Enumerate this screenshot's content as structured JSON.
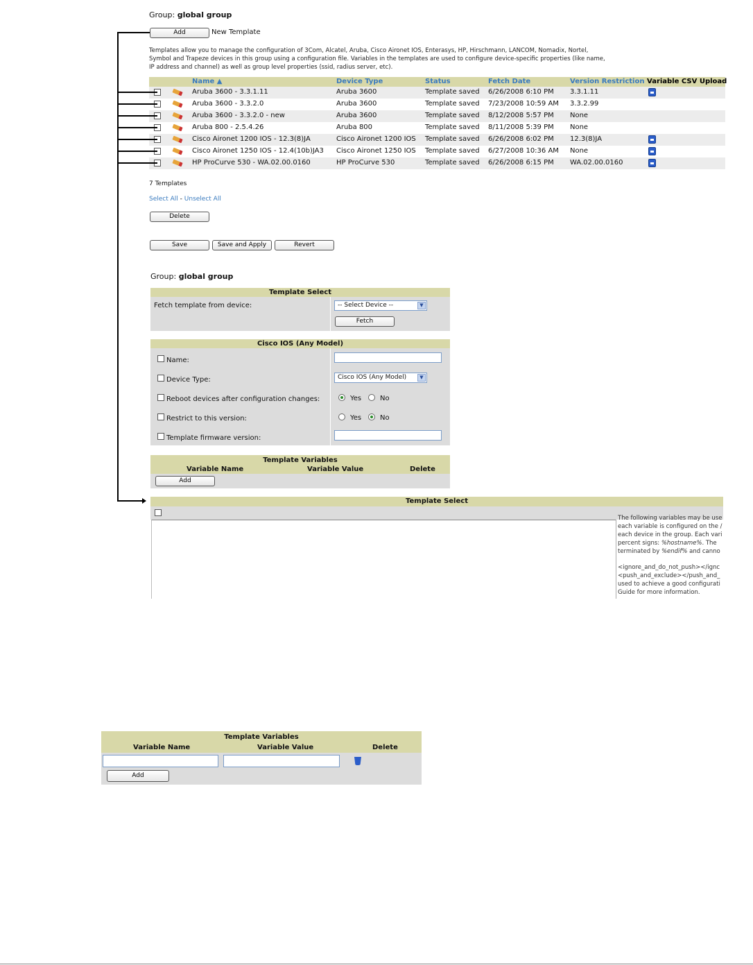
{
  "top": {
    "group_label": "Group:",
    "group_name": "global group",
    "add_button": "Add",
    "new_template_label": "New Template",
    "description_1": "Templates allow you to manage the configuration of 3Com, Alcatel, Aruba, Cisco Aironet IOS, Enterasys, HP, Hirschmann, LANCOM, Nomadix, Nortel,",
    "description_2": "Symbol and Trapeze devices in this group using a configuration file. Variables in the templates are used to configure device-specific properties (like name,",
    "description_3": "IP address and channel) as well as group level properties (ssid, radius server, etc)."
  },
  "table": {
    "headers": {
      "name": "Name ▲",
      "device_type": "Device Type",
      "status": "Status",
      "fetch_date": "Fetch Date",
      "version_restriction": "Version Restriction",
      "variable_csv_upload": "Variable CSV Upload"
    },
    "rows": [
      {
        "name": "Aruba 3600 - 3.3.1.11",
        "device_type": "Aruba 3600",
        "status": "Template saved",
        "fetch_date": "6/26/2008 6:10 PM",
        "version": "3.3.1.11",
        "csv": true
      },
      {
        "name": "Aruba 3600 - 3.3.2.0",
        "device_type": "Aruba 3600",
        "status": "Template saved",
        "fetch_date": "7/23/2008 10:59 AM",
        "version": "3.3.2.99",
        "csv": false
      },
      {
        "name": "Aruba 3600 - 3.3.2.0 - new",
        "device_type": "Aruba 3600",
        "status": "Template saved",
        "fetch_date": "8/12/2008 5:57 PM",
        "version": "None",
        "csv": false
      },
      {
        "name": "Aruba 800 - 2.5.4.26",
        "device_type": "Aruba 800",
        "status": "Template saved",
        "fetch_date": "8/11/2008 5:39 PM",
        "version": "None",
        "csv": false
      },
      {
        "name": "Cisco Aironet 1200 IOS - 12.3(8)JA",
        "device_type": "Cisco Aironet 1200 IOS",
        "status": "Template saved",
        "fetch_date": "6/26/2008 6:02 PM",
        "version": "12.3(8)JA",
        "csv": true
      },
      {
        "name": "Cisco Aironet 1250 IOS - 12.4(10b)JA3",
        "device_type": "Cisco Aironet 1250 IOS",
        "status": "Template saved",
        "fetch_date": "6/27/2008 10:36 AM",
        "version": "None",
        "csv": true
      },
      {
        "name": "HP ProCurve 530 - WA.02.00.0160",
        "device_type": "HP ProCurve 530",
        "status": "Template saved",
        "fetch_date": "6/26/2008 6:15 PM",
        "version": "WA.02.00.0160",
        "csv": true
      }
    ],
    "count_label": "7 Templates",
    "select_all": "Select All",
    "separator": " - ",
    "unselect_all": "Unselect All",
    "delete_button": "Delete",
    "save_button": "Save",
    "save_apply_button": "Save and Apply",
    "revert_button": "Revert"
  },
  "form": {
    "group_label": "Group:",
    "group_name": "global group",
    "template_select_title": "Template Select",
    "fetch_label": "Fetch template from device:",
    "select_device": "-- Select Device --",
    "fetch_button": "Fetch",
    "cisco_title": "Cisco IOS (Any Model)",
    "name_label": "Name:",
    "device_type_label": "Device Type:",
    "device_type_value": "Cisco IOS (Any Model)",
    "reboot_label": "Reboot devices after configuration changes:",
    "restrict_label": "Restrict to this version:",
    "firmware_label": "Template firmware version:",
    "yes": "Yes",
    "no": "No",
    "vars_title": "Template Variables",
    "var_name": "Variable Name",
    "var_value": "Variable Value",
    "var_delete": "Delete",
    "vars_add": "Add",
    "bottom_template_select": "Template Select",
    "help_lines": [
      "The following variables may be use",
      "each variable is configured on the /",
      "each device in the group. Each vari",
      "percent signs:",
      "terminated by",
      "",
      "<ignore_and_do_not_push></ignc",
      "<push_and_exclude></push_and_",
      "used to achieve a good configurati",
      "Guide for more information."
    ],
    "help_italic_1": "%hostname%",
    "help_after_1": ". The",
    "help_italic_2": "%endif%",
    "help_after_2": " and canno"
  },
  "lower": {
    "vars_title": "Template Variables",
    "var_name": "Variable Name",
    "var_value": "Variable Value",
    "var_delete": "Delete",
    "add_button": "Add"
  }
}
